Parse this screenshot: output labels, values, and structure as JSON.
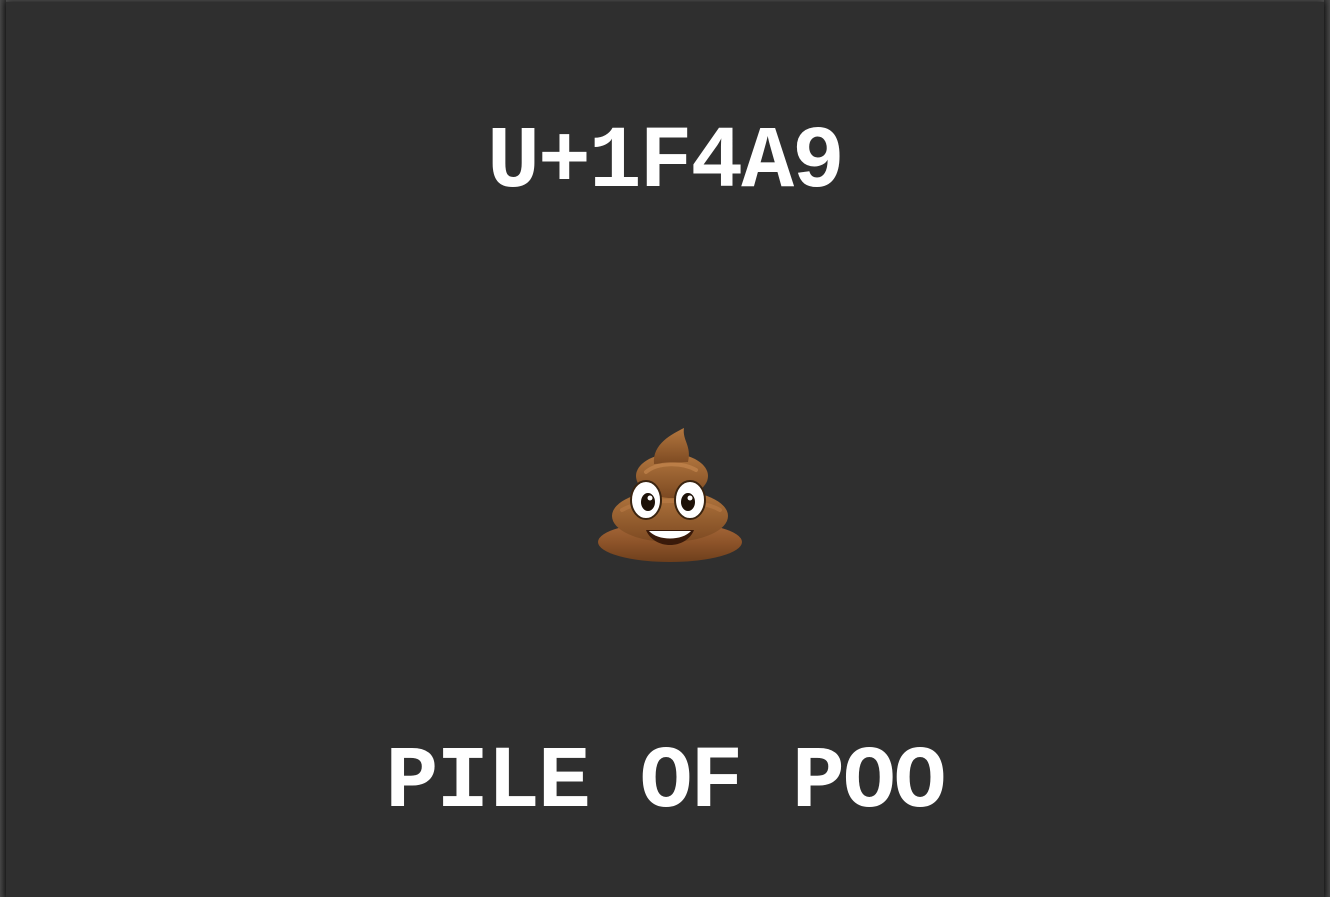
{
  "slide": {
    "codepoint": "U+1F4A9",
    "name": "PILE OF POO",
    "emoji_icon": "pile-of-poo-icon"
  },
  "colors": {
    "background": "#2f2f2f",
    "text": "#ffffff",
    "emoji_brown": "#8b5a2b"
  }
}
